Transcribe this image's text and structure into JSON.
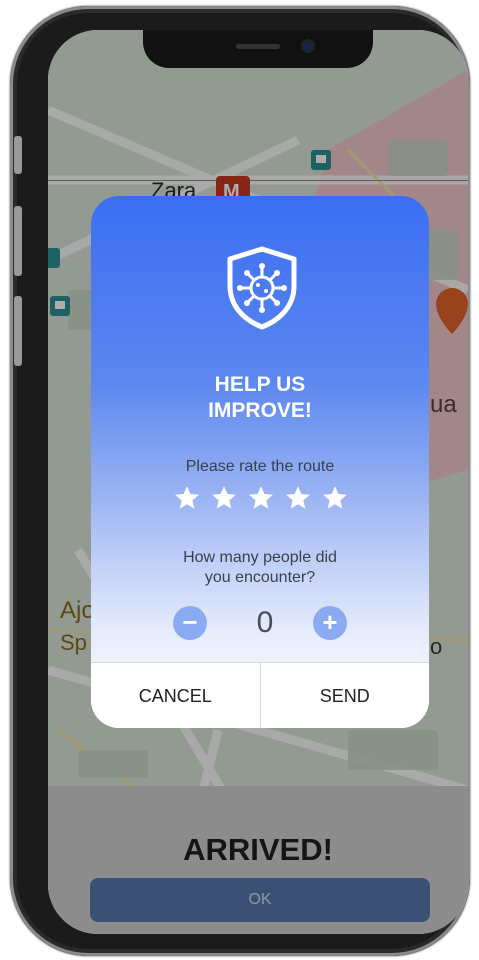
{
  "map": {
    "labels": [
      "Zara",
      "Ajo",
      "Sp",
      "ua",
      "o"
    ],
    "metro_badge": "M"
  },
  "dialog": {
    "title_line1": "HELP US",
    "title_line2": "IMPROVE!",
    "rate_label": "Please rate the route",
    "stars": 5,
    "people_label_line1": "How many people did",
    "people_label_line2": "you encounter?",
    "minus_label": "−",
    "plus_label": "+",
    "count": "0",
    "cancel_label": "CANCEL",
    "send_label": "SEND"
  },
  "status": {
    "arrived": "ARRIVED!",
    "ok_label": "OK"
  },
  "colors": {
    "dialog_top": "#3b6ef2",
    "accent": "#8aaaf2",
    "ok_button": "#3b5174"
  },
  "icons": [
    "virus-shield-icon",
    "star-icon",
    "minus-icon",
    "plus-icon",
    "bus-stop-icon",
    "restaurant-pin-icon",
    "metro-icon"
  ]
}
